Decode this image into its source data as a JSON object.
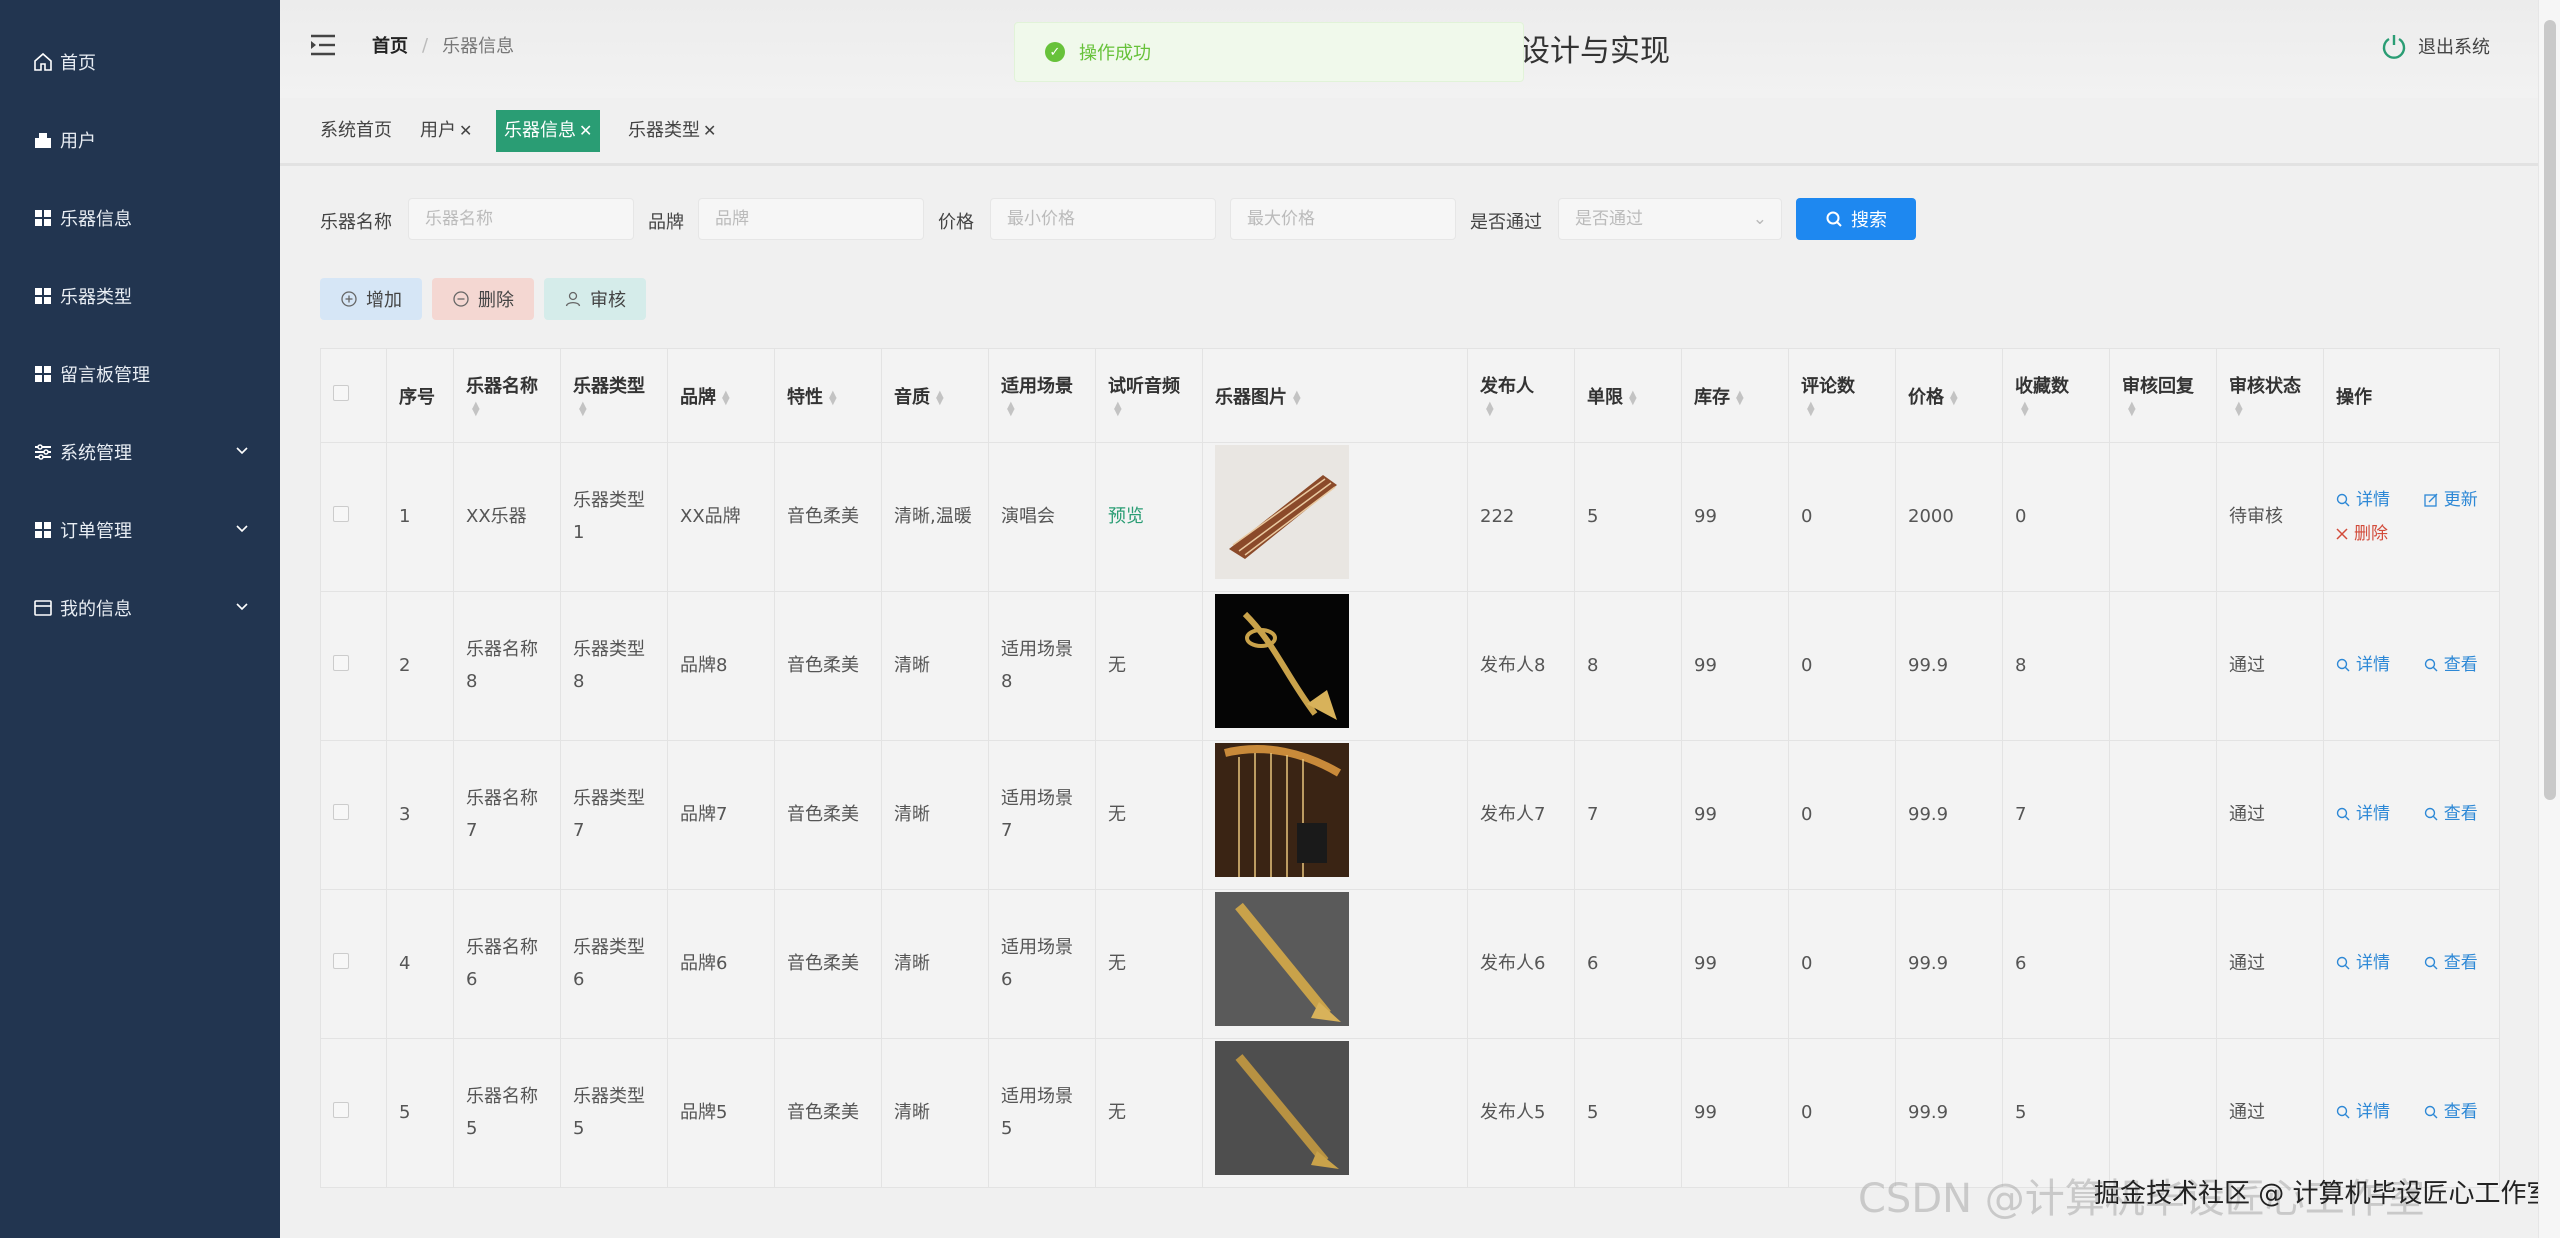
{
  "sidebar": {
    "items": [
      {
        "label": "首页",
        "icon": "home-icon"
      },
      {
        "label": "用户",
        "icon": "user-icon"
      },
      {
        "label": "乐器信息",
        "icon": "grid-icon"
      },
      {
        "label": "乐器类型",
        "icon": "grid-icon"
      },
      {
        "label": "留言板管理",
        "icon": "grid-icon"
      },
      {
        "label": "系统管理",
        "icon": "settings-icon"
      },
      {
        "label": "订单管理",
        "icon": "grid-icon"
      },
      {
        "label": "我的信息",
        "icon": "card-icon"
      }
    ]
  },
  "header": {
    "breadcrumb_home": "首页",
    "breadcrumb_sep": "/",
    "breadcrumb_current": "乐器信息",
    "title": "设计与实现",
    "logout": "退出系统"
  },
  "toast": {
    "message": "操作成功"
  },
  "tabs": [
    {
      "label": "系统首页",
      "closable": false
    },
    {
      "label": "用户",
      "closable": true
    },
    {
      "label": "乐器信息",
      "closable": true,
      "active": true
    },
    {
      "label": "乐器类型",
      "closable": true
    }
  ],
  "search": {
    "name_label": "乐器名称",
    "name_placeholder": "乐器名称",
    "brand_label": "品牌",
    "brand_placeholder": "品牌",
    "price_label": "价格",
    "min_price_placeholder": "最小价格",
    "max_price_placeholder": "最大价格",
    "pass_label": "是否通过",
    "pass_placeholder": "是否通过",
    "search_button": "搜索"
  },
  "actions": {
    "add": "增加",
    "delete": "删除",
    "audit": "审核"
  },
  "table": {
    "headers": [
      "序号",
      "乐器名称",
      "乐器类型",
      "品牌",
      "特性",
      "音质",
      "适用场景",
      "试听音频",
      "乐器图片",
      "发布人",
      "单限",
      "库存",
      "评论数",
      "价格",
      "收藏数",
      "审核回复",
      "审核状态",
      "操作"
    ],
    "op_labels": {
      "detail": "详情",
      "update": "更新",
      "delete": "删除",
      "view": "查看"
    },
    "rows": [
      {
        "no": "1",
        "name": "XX乐器",
        "type": "乐器类型1",
        "brand": "XX品牌",
        "feature": "音色柔美",
        "quality": "清晰,温暖",
        "scene": "演唱会",
        "audio": "预览",
        "publisher": "222",
        "limit": "5",
        "stock": "99",
        "comments": "0",
        "price": "2000",
        "favorites": "0",
        "reply": "",
        "status": "待审核"
      },
      {
        "no": "2",
        "name": "乐器名称8",
        "type": "乐器类型8",
        "brand": "品牌8",
        "feature": "音色柔美",
        "quality": "清晰",
        "scene": "适用场景8",
        "audio": "无",
        "publisher": "发布人8",
        "limit": "8",
        "stock": "99",
        "comments": "0",
        "price": "99.9",
        "favorites": "8",
        "reply": "",
        "status": "通过"
      },
      {
        "no": "3",
        "name": "乐器名称7",
        "type": "乐器类型7",
        "brand": "品牌7",
        "feature": "音色柔美",
        "quality": "清晰",
        "scene": "适用场景7",
        "audio": "无",
        "publisher": "发布人7",
        "limit": "7",
        "stock": "99",
        "comments": "0",
        "price": "99.9",
        "favorites": "7",
        "reply": "",
        "status": "通过"
      },
      {
        "no": "4",
        "name": "乐器名称6",
        "type": "乐器类型6",
        "brand": "品牌6",
        "feature": "音色柔美",
        "quality": "清晰",
        "scene": "适用场景6",
        "audio": "无",
        "publisher": "发布人6",
        "limit": "6",
        "stock": "99",
        "comments": "0",
        "price": "99.9",
        "favorites": "6",
        "reply": "",
        "status": "通过"
      },
      {
        "no": "5",
        "name": "乐器名称5",
        "type": "乐器类型5",
        "brand": "品牌5",
        "feature": "音色柔美",
        "quality": "清晰",
        "scene": "适用场景5",
        "audio": "无",
        "publisher": "发布人5",
        "limit": "5",
        "stock": "99",
        "comments": "0",
        "price": "99.9",
        "favorites": "5",
        "reply": "",
        "status": "通过"
      }
    ]
  },
  "watermark": "CSDN @计算机毕设匠心工作室",
  "watermark2": "掘金技术社区 @ 计算机毕设匠心工作室",
  "colors": {
    "sidebar": "#223550",
    "accent": "#2a9d74",
    "primary": "#1e88f0",
    "success": "#67c23a",
    "danger": "#d24b3a"
  }
}
